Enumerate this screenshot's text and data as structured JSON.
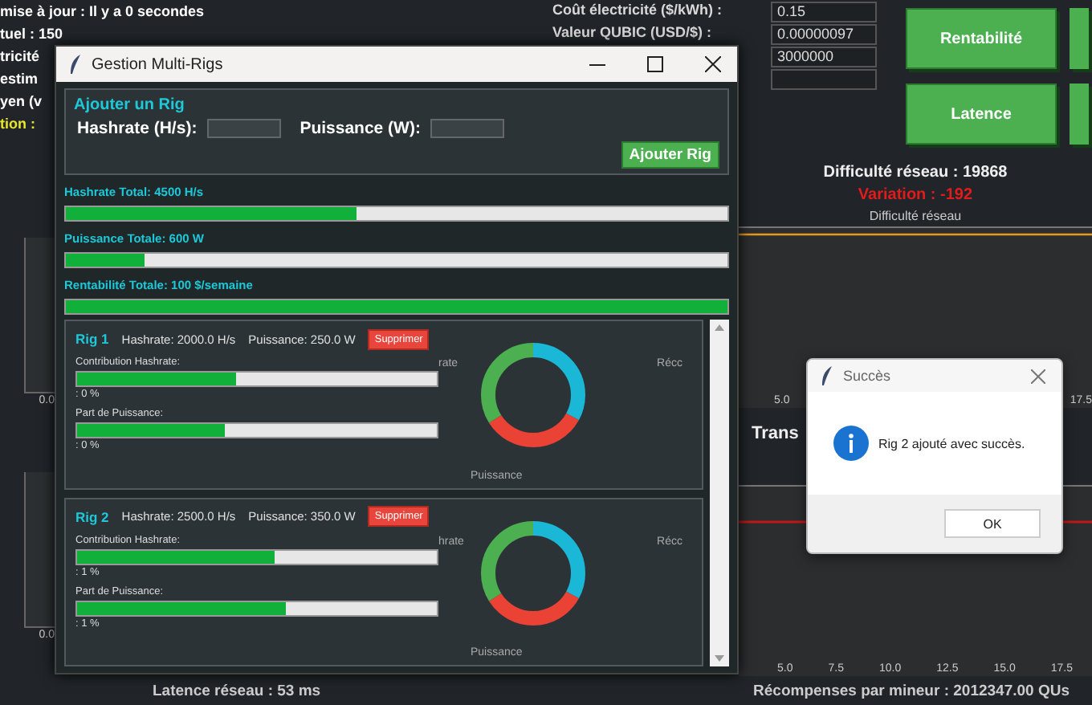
{
  "background_app": {
    "status_lines": [
      {
        "text": "mise à jour : Il y a 0 secondes",
        "kind": "normal"
      },
      {
        "text": "tuel : 150",
        "kind": "normal"
      },
      {
        "text": "tricité",
        "kind": "normal"
      },
      {
        "text": "estim",
        "kind": "normal"
      },
      {
        "text": "yen (v",
        "kind": "normal"
      },
      {
        "text": "tion :",
        "kind": "highlight"
      }
    ],
    "settings": [
      {
        "kind": "labeled",
        "label": "Coût électricité ($/kWh) :",
        "value": "0.15"
      },
      {
        "kind": "labeled",
        "label": "Valeur QUBIC (USD/$) :",
        "value": "0.00000097"
      },
      {
        "kind": "bare",
        "value": "3000000"
      },
      {
        "kind": "bare"
      }
    ],
    "buttons": [
      {
        "label": "Rentabilité"
      },
      {
        "label": "Latence"
      }
    ],
    "difficulty": "Difficulté réseau : 19868",
    "variation": "Variation : -192",
    "difficulty_chart": {
      "title": "Difficulté réseau",
      "x_ticks": [
        "5.0",
        "17.5"
      ]
    },
    "mini_charts": [
      {
        "tick": "0.0"
      },
      {
        "tick": "0.0"
      }
    ],
    "transactions_label": "Trans",
    "second_chart": {
      "x_ticks": [
        "5.0",
        "7.5",
        "10.0",
        "12.5",
        "15.0",
        "17.5"
      ]
    },
    "footer": [
      "Latence réseau : 53 ms",
      "Récompenses par mineur : 2012347.00 QUs"
    ]
  },
  "window": {
    "title": "Gestion Multi-Rigs",
    "add_panel": {
      "title": "Ajouter un Rig",
      "fields": [
        {
          "label": "Hashrate (H/s):"
        },
        {
          "label": "Puissance (W):"
        }
      ],
      "button": "Ajouter Rig"
    },
    "totals": [
      {
        "label": "Hashrate Total: 4500 H/s",
        "level": 0.44
      },
      {
        "label": "Puissance Totale: 600 W",
        "level": 0.12
      },
      {
        "label": "Rentabilité Totale: 100 $/semaine",
        "level": 1
      }
    ],
    "rigs": [
      {
        "name": "Rig 1",
        "hashrate": "Hashrate: 2000.0 H/s",
        "power": "Puissance: 250.0 W",
        "delete_button": "Supprimer",
        "metrics": [
          {
            "label": "Contribution Hashrate:",
            "level": 0.44,
            "reading": ": 0 %"
          },
          {
            "label": "Part de Puissance:",
            "level": 0.41,
            "reading": ": 0 %"
          }
        ],
        "donut_labels": [
          "rate",
          "Récc",
          "Puissance"
        ]
      },
      {
        "name": "Rig 2",
        "hashrate": "Hashrate: 2500.0 H/s",
        "power": "Puissance: 350.0 W",
        "delete_button": "Supprimer",
        "metrics": [
          {
            "label": "Contribution Hashrate:",
            "level": 0.55,
            "reading": ": 1 %"
          },
          {
            "label": "Part de Puissance:",
            "level": 0.58,
            "reading": ": 1 %"
          }
        ],
        "donut_labels": [
          "hrate",
          "Récc",
          "Puissance"
        ]
      }
    ]
  },
  "dialog": {
    "title": "Succès",
    "message": "Rig 2 ajouté avec succès.",
    "button": "OK"
  }
}
